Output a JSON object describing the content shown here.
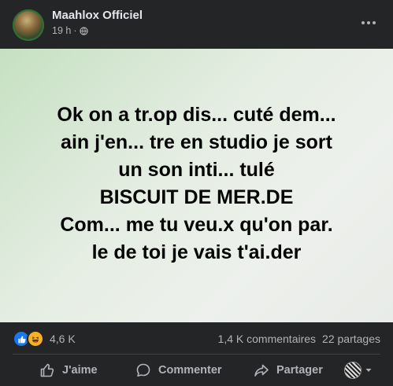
{
  "post": {
    "author": "Maahlox Officiel",
    "time": "19 h",
    "separator": "·",
    "content_lines": [
      "Ok on a tr.op dis... cuté dem...",
      "ain j'en... tre en studio je sort",
      "un son inti... tulé",
      "BISCUIT DE MER.DE",
      "Com... me tu veu.x qu'on par.",
      "le de toi je vais t'ai.der"
    ]
  },
  "stats": {
    "reaction_count": "4,6 K",
    "comments": "1,4 K commentaires",
    "shares": "22 partages"
  },
  "actions": {
    "like": "J'aime",
    "comment": "Commenter",
    "share": "Partager"
  },
  "icons": {
    "globe": "globe-icon",
    "more": "more-options-icon",
    "like_reaction": "like-reaction-icon",
    "haha_reaction": "haha-reaction-icon",
    "thumbs_up": "thumbs-up-icon",
    "comment": "comment-icon",
    "share": "share-icon",
    "chevron": "chevron-down-icon"
  },
  "colors": {
    "background": "#242526",
    "primary_text": "#e4e6eb",
    "secondary_text": "#b0b3b8",
    "like_blue": "#1877f2",
    "haha_yellow": "#f7b125"
  }
}
